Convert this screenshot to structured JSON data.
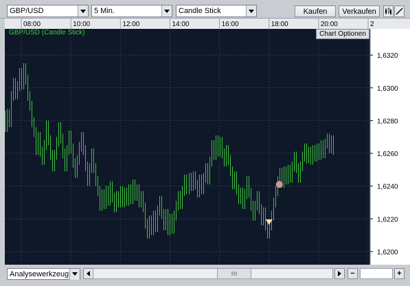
{
  "toolbar": {
    "symbol": "GBP/USD",
    "interval": "5 Min.",
    "chart_type": "Candle Stick",
    "buy_label": "Kaufen",
    "sell_label": "Verkaufen",
    "icons": [
      "candlestick-view-icon",
      "draw-line-icon"
    ]
  },
  "chart": {
    "title": "GBP/USD (Candle Stick)",
    "options_label": "Chart Optionen",
    "colors": {
      "background": "#0f1828",
      "grid": "#2c3a58",
      "candles": "#3ec23e",
      "label": "#2fd02f",
      "buy_marker": "#c79aa0",
      "sell_marker": "#f3e7a8"
    }
  },
  "bottom": {
    "tool_select": "Analysewerkzeug",
    "zoom_out": "−",
    "zoom_in": "+"
  },
  "chart_data": {
    "type": "candlestick",
    "title": "GBP/USD (Candle Stick)",
    "x_ticks": [
      "08:00",
      "10:00",
      "12:00",
      "14:00",
      "16:00",
      "18:00",
      "20:00",
      "2"
    ],
    "y_ticks": [
      "1,6320",
      "1,6300",
      "1,6280",
      "1,6260",
      "1,6240",
      "1,6220",
      "1,6200"
    ],
    "ylim": [
      1.6192,
      1.6336
    ],
    "xlim": [
      "07:20",
      "22:05"
    ],
    "grid": true,
    "series": [
      {
        "values": [
          {
            "t": "07:20",
            "o": 1.6283,
            "c": 1.6276
          },
          {
            "t": "07:25",
            "o": 1.6276,
            "c": 1.6284
          },
          {
            "t": "07:30",
            "o": 1.6284,
            "c": 1.6279
          },
          {
            "t": "07:35",
            "o": 1.6279,
            "c": 1.6295
          },
          {
            "t": "07:40",
            "o": 1.6295,
            "c": 1.6303
          },
          {
            "t": "07:45",
            "o": 1.6303,
            "c": 1.6296
          },
          {
            "t": "07:50",
            "o": 1.6296,
            "c": 1.6301
          },
          {
            "t": "07:55",
            "o": 1.6301,
            "c": 1.6309
          },
          {
            "t": "08:00",
            "o": 1.6309,
            "c": 1.6302
          },
          {
            "t": "08:05",
            "o": 1.6302,
            "c": 1.6312
          },
          {
            "t": "08:10",
            "o": 1.6312,
            "c": 1.6305
          },
          {
            "t": "08:15",
            "o": 1.6305,
            "c": 1.6295
          },
          {
            "t": "08:20",
            "o": 1.6295,
            "c": 1.6289
          },
          {
            "t": "08:25",
            "o": 1.6289,
            "c": 1.6279
          },
          {
            "t": "08:30",
            "o": 1.6279,
            "c": 1.6273
          },
          {
            "t": "08:35",
            "o": 1.6273,
            "c": 1.6262
          },
          {
            "t": "08:40",
            "o": 1.6262,
            "c": 1.627
          },
          {
            "t": "08:45",
            "o": 1.627,
            "c": 1.6261
          },
          {
            "t": "08:50",
            "o": 1.6261,
            "c": 1.6256
          },
          {
            "t": "08:55",
            "o": 1.6256,
            "c": 1.6265
          },
          {
            "t": "09:00",
            "o": 1.6265,
            "c": 1.6277
          },
          {
            "t": "09:05",
            "o": 1.6277,
            "c": 1.6268
          },
          {
            "t": "09:10",
            "o": 1.6268,
            "c": 1.6259
          },
          {
            "t": "09:15",
            "o": 1.6259,
            "c": 1.6252
          },
          {
            "t": "09:20",
            "o": 1.6252,
            "c": 1.6259
          },
          {
            "t": "09:25",
            "o": 1.6259,
            "c": 1.6267
          },
          {
            "t": "09:30",
            "o": 1.6267,
            "c": 1.6276
          },
          {
            "t": "09:35",
            "o": 1.6276,
            "c": 1.6269
          },
          {
            "t": "09:40",
            "o": 1.6269,
            "c": 1.626
          },
          {
            "t": "09:45",
            "o": 1.626,
            "c": 1.6252
          },
          {
            "t": "09:50",
            "o": 1.6252,
            "c": 1.6262
          },
          {
            "t": "09:55",
            "o": 1.6262,
            "c": 1.6271
          },
          {
            "t": "10:00",
            "o": 1.6271,
            "c": 1.6263
          },
          {
            "t": "10:05",
            "o": 1.6263,
            "c": 1.6254
          },
          {
            "t": "10:10",
            "o": 1.6254,
            "c": 1.6248
          },
          {
            "t": "10:15",
            "o": 1.6248,
            "c": 1.6256
          },
          {
            "t": "10:20",
            "o": 1.6256,
            "c": 1.6264
          },
          {
            "t": "10:25",
            "o": 1.6264,
            "c": 1.627
          },
          {
            "t": "10:30",
            "o": 1.627,
            "c": 1.6262
          },
          {
            "t": "10:35",
            "o": 1.6262,
            "c": 1.6252
          },
          {
            "t": "10:40",
            "o": 1.6252,
            "c": 1.6243
          },
          {
            "t": "10:45",
            "o": 1.6243,
            "c": 1.6251
          },
          {
            "t": "10:50",
            "o": 1.6251,
            "c": 1.626
          },
          {
            "t": "10:55",
            "o": 1.626,
            "c": 1.6251
          },
          {
            "t": "11:00",
            "o": 1.6251,
            "c": 1.6243
          },
          {
            "t": "11:05",
            "o": 1.6243,
            "c": 1.6237
          },
          {
            "t": "11:10",
            "o": 1.6237,
            "c": 1.6228
          },
          {
            "t": "11:15",
            "o": 1.6228,
            "c": 1.6235
          },
          {
            "t": "11:20",
            "o": 1.6235,
            "c": 1.6229
          },
          {
            "t": "11:25",
            "o": 1.6229,
            "c": 1.6237
          },
          {
            "t": "11:30",
            "o": 1.6237,
            "c": 1.6231
          },
          {
            "t": "11:35",
            "o": 1.6231,
            "c": 1.624
          },
          {
            "t": "11:40",
            "o": 1.624,
            "c": 1.6233
          },
          {
            "t": "11:45",
            "o": 1.6233,
            "c": 1.6227
          },
          {
            "t": "11:50",
            "o": 1.6227,
            "c": 1.6234
          },
          {
            "t": "11:55",
            "o": 1.6234,
            "c": 1.623
          },
          {
            "t": "12:00",
            "o": 1.623,
            "c": 1.6237
          },
          {
            "t": "12:05",
            "o": 1.6237,
            "c": 1.623
          },
          {
            "t": "12:10",
            "o": 1.623,
            "c": 1.6236
          },
          {
            "t": "12:15",
            "o": 1.6236,
            "c": 1.6231
          },
          {
            "t": "12:20",
            "o": 1.6231,
            "c": 1.6238
          },
          {
            "t": "12:25",
            "o": 1.6238,
            "c": 1.6232
          },
          {
            "t": "12:30",
            "o": 1.6232,
            "c": 1.6241
          },
          {
            "t": "12:35",
            "o": 1.6241,
            "c": 1.6234
          },
          {
            "t": "12:40",
            "o": 1.6234,
            "c": 1.6238
          },
          {
            "t": "12:45",
            "o": 1.6238,
            "c": 1.623
          },
          {
            "t": "12:50",
            "o": 1.623,
            "c": 1.6234
          },
          {
            "t": "12:55",
            "o": 1.6234,
            "c": 1.6227
          },
          {
            "t": "13:00",
            "o": 1.6227,
            "c": 1.6217
          },
          {
            "t": "13:05",
            "o": 1.6217,
            "c": 1.6211
          },
          {
            "t": "13:10",
            "o": 1.6211,
            "c": 1.6219
          },
          {
            "t": "13:15",
            "o": 1.6219,
            "c": 1.6213
          },
          {
            "t": "13:20",
            "o": 1.6213,
            "c": 1.6222
          },
          {
            "t": "13:25",
            "o": 1.6222,
            "c": 1.6215
          },
          {
            "t": "13:30",
            "o": 1.6215,
            "c": 1.6225
          },
          {
            "t": "13:35",
            "o": 1.6225,
            "c": 1.6231
          },
          {
            "t": "13:40",
            "o": 1.6231,
            "c": 1.6223
          },
          {
            "t": "13:45",
            "o": 1.6223,
            "c": 1.6216
          },
          {
            "t": "13:50",
            "o": 1.6216,
            "c": 1.6223
          },
          {
            "t": "13:55",
            "o": 1.6223,
            "c": 1.6213
          },
          {
            "t": "14:00",
            "o": 1.6213,
            "c": 1.622
          },
          {
            "t": "14:05",
            "o": 1.622,
            "c": 1.6214
          },
          {
            "t": "14:10",
            "o": 1.6214,
            "c": 1.6222
          },
          {
            "t": "14:15",
            "o": 1.6222,
            "c": 1.6228
          },
          {
            "t": "14:20",
            "o": 1.6228,
            "c": 1.6234
          },
          {
            "t": "14:25",
            "o": 1.6234,
            "c": 1.6229
          },
          {
            "t": "14:30",
            "o": 1.6229,
            "c": 1.6237
          },
          {
            "t": "14:35",
            "o": 1.6237,
            "c": 1.6244
          },
          {
            "t": "14:40",
            "o": 1.6244,
            "c": 1.6238
          },
          {
            "t": "14:45",
            "o": 1.6238,
            "c": 1.6245
          },
          {
            "t": "14:50",
            "o": 1.6245,
            "c": 1.624
          },
          {
            "t": "14:55",
            "o": 1.624,
            "c": 1.6246
          },
          {
            "t": "15:00",
            "o": 1.6246,
            "c": 1.6241
          },
          {
            "t": "15:05",
            "o": 1.6241,
            "c": 1.6236
          },
          {
            "t": "15:10",
            "o": 1.6236,
            "c": 1.6244
          },
          {
            "t": "15:15",
            "o": 1.6244,
            "c": 1.6238
          },
          {
            "t": "15:20",
            "o": 1.6238,
            "c": 1.6245
          },
          {
            "t": "15:25",
            "o": 1.6245,
            "c": 1.6251
          },
          {
            "t": "15:30",
            "o": 1.6251,
            "c": 1.6244
          },
          {
            "t": "15:35",
            "o": 1.6244,
            "c": 1.6255
          },
          {
            "t": "15:40",
            "o": 1.6255,
            "c": 1.6265
          },
          {
            "t": "15:45",
            "o": 1.6265,
            "c": 1.6259
          },
          {
            "t": "15:50",
            "o": 1.6259,
            "c": 1.6268
          },
          {
            "t": "15:55",
            "o": 1.6268,
            "c": 1.6261
          },
          {
            "t": "16:00",
            "o": 1.6261,
            "c": 1.6267
          },
          {
            "t": "16:05",
            "o": 1.6267,
            "c": 1.626
          },
          {
            "t": "16:10",
            "o": 1.626,
            "c": 1.6255
          },
          {
            "t": "16:15",
            "o": 1.6255,
            "c": 1.6262
          },
          {
            "t": "16:20",
            "o": 1.6262,
            "c": 1.6256
          },
          {
            "t": "16:25",
            "o": 1.6256,
            "c": 1.6249
          },
          {
            "t": "16:30",
            "o": 1.6249,
            "c": 1.6241
          },
          {
            "t": "16:35",
            "o": 1.6241,
            "c": 1.6246
          },
          {
            "t": "16:40",
            "o": 1.6246,
            "c": 1.6238
          },
          {
            "t": "16:45",
            "o": 1.6238,
            "c": 1.6232
          },
          {
            "t": "16:50",
            "o": 1.6232,
            "c": 1.6236
          },
          {
            "t": "16:55",
            "o": 1.6236,
            "c": 1.6229
          },
          {
            "t": "17:00",
            "o": 1.6229,
            "c": 1.6235
          },
          {
            "t": "17:05",
            "o": 1.6235,
            "c": 1.6243
          },
          {
            "t": "17:10",
            "o": 1.6243,
            "c": 1.6236
          },
          {
            "t": "17:15",
            "o": 1.6236,
            "c": 1.6228
          },
          {
            "t": "17:20",
            "o": 1.6228,
            "c": 1.6222
          },
          {
            "t": "17:25",
            "o": 1.6222,
            "c": 1.6228
          },
          {
            "t": "17:30",
            "o": 1.6228,
            "c": 1.6234
          },
          {
            "t": "17:35",
            "o": 1.6234,
            "c": 1.6226
          },
          {
            "t": "17:40",
            "o": 1.6226,
            "c": 1.6219
          },
          {
            "t": "17:45",
            "o": 1.6219,
            "c": 1.6224
          },
          {
            "t": "17:50",
            "o": 1.6224,
            "c": 1.6216
          },
          {
            "t": "17:55",
            "o": 1.6216,
            "c": 1.6211
          },
          {
            "t": "18:00",
            "o": 1.6211,
            "c": 1.6216
          },
          {
            "t": "18:05",
            "o": 1.6216,
            "c": 1.6222
          },
          {
            "t": "18:10",
            "o": 1.6222,
            "c": 1.623
          },
          {
            "t": "18:15",
            "o": 1.623,
            "c": 1.6237
          },
          {
            "t": "18:20",
            "o": 1.6237,
            "c": 1.6243
          },
          {
            "t": "18:25",
            "o": 1.6243,
            "c": 1.6248
          },
          {
            "t": "18:30",
            "o": 1.6248,
            "c": 1.6242
          },
          {
            "t": "18:35",
            "o": 1.6242,
            "c": 1.6249
          },
          {
            "t": "18:40",
            "o": 1.6249,
            "c": 1.6244
          },
          {
            "t": "18:45",
            "o": 1.6244,
            "c": 1.625
          },
          {
            "t": "18:50",
            "o": 1.625,
            "c": 1.6245
          },
          {
            "t": "18:55",
            "o": 1.6245,
            "c": 1.6252
          },
          {
            "t": "19:00",
            "o": 1.6252,
            "c": 1.6258
          },
          {
            "t": "19:05",
            "o": 1.6258,
            "c": 1.6251
          },
          {
            "t": "19:10",
            "o": 1.6251,
            "c": 1.6245
          },
          {
            "t": "19:15",
            "o": 1.6245,
            "c": 1.6252
          },
          {
            "t": "19:20",
            "o": 1.6252,
            "c": 1.6258
          },
          {
            "t": "19:25",
            "o": 1.6258,
            "c": 1.6263
          },
          {
            "t": "19:30",
            "o": 1.6263,
            "c": 1.6257
          },
          {
            "t": "19:35",
            "o": 1.6257,
            "c": 1.6261
          },
          {
            "t": "19:40",
            "o": 1.6261,
            "c": 1.6256
          },
          {
            "t": "19:45",
            "o": 1.6256,
            "c": 1.6262
          },
          {
            "t": "19:50",
            "o": 1.6262,
            "c": 1.6258
          },
          {
            "t": "19:55",
            "o": 1.6258,
            "c": 1.6263
          },
          {
            "t": "20:00",
            "o": 1.6263,
            "c": 1.6259
          },
          {
            "t": "20:05",
            "o": 1.6259,
            "c": 1.6265
          },
          {
            "t": "20:10",
            "o": 1.6265,
            "c": 1.626
          },
          {
            "t": "20:15",
            "o": 1.626,
            "c": 1.6266
          },
          {
            "t": "20:20",
            "o": 1.6266,
            "c": 1.6269
          },
          {
            "t": "20:25",
            "o": 1.6269,
            "c": 1.6263
          },
          {
            "t": "20:30",
            "o": 1.6263,
            "c": 1.6268
          },
          {
            "t": "20:35",
            "o": 1.6268,
            "c": 1.6262
          }
        ]
      }
    ],
    "markers": [
      {
        "type": "buy",
        "t": "18:25",
        "y": 1.6241
      },
      {
        "type": "sell",
        "t": "18:00",
        "y": 1.6218
      }
    ]
  }
}
